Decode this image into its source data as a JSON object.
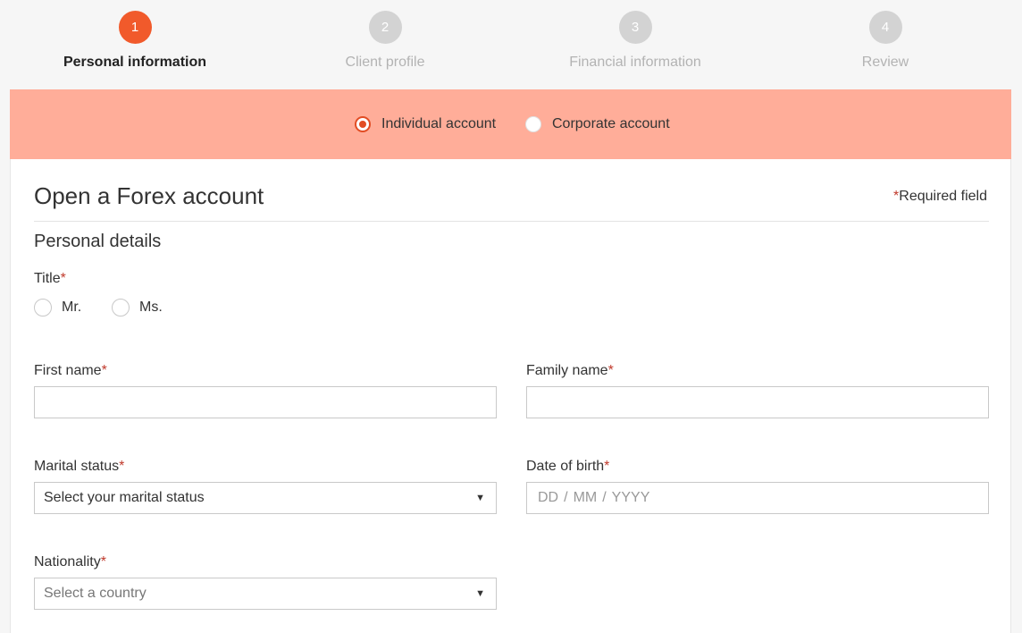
{
  "stepper": {
    "steps": [
      {
        "number": "1",
        "label": "Personal information",
        "active": true
      },
      {
        "number": "2",
        "label": "Client profile",
        "active": false
      },
      {
        "number": "3",
        "label": "Financial information",
        "active": false
      },
      {
        "number": "4",
        "label": "Review",
        "active": false
      }
    ]
  },
  "account_type": {
    "individual_label": "Individual account",
    "corporate_label": "Corporate account",
    "selected": "Individual account"
  },
  "form": {
    "title": "Open a Forex account",
    "required_star": "*",
    "required_note": "Required field",
    "section_title": "Personal details",
    "title_field": {
      "label": "Title",
      "options": [
        "Mr.",
        "Ms."
      ]
    },
    "first_name": {
      "label": "First name",
      "value": ""
    },
    "family_name": {
      "label": "Family name",
      "value": ""
    },
    "marital_status": {
      "label": "Marital status",
      "selected": "Select your marital status"
    },
    "date_of_birth": {
      "label": "Date of birth",
      "day": "DD",
      "month": "MM",
      "year": "YYYY",
      "separator": "/"
    },
    "nationality": {
      "label": "Nationality",
      "selected": "Select a country"
    }
  },
  "colors": {
    "accent": "#f15a2b",
    "band": "#ffad99",
    "inactive_step": "#d3d3d3",
    "required_star": "#c0392b"
  }
}
